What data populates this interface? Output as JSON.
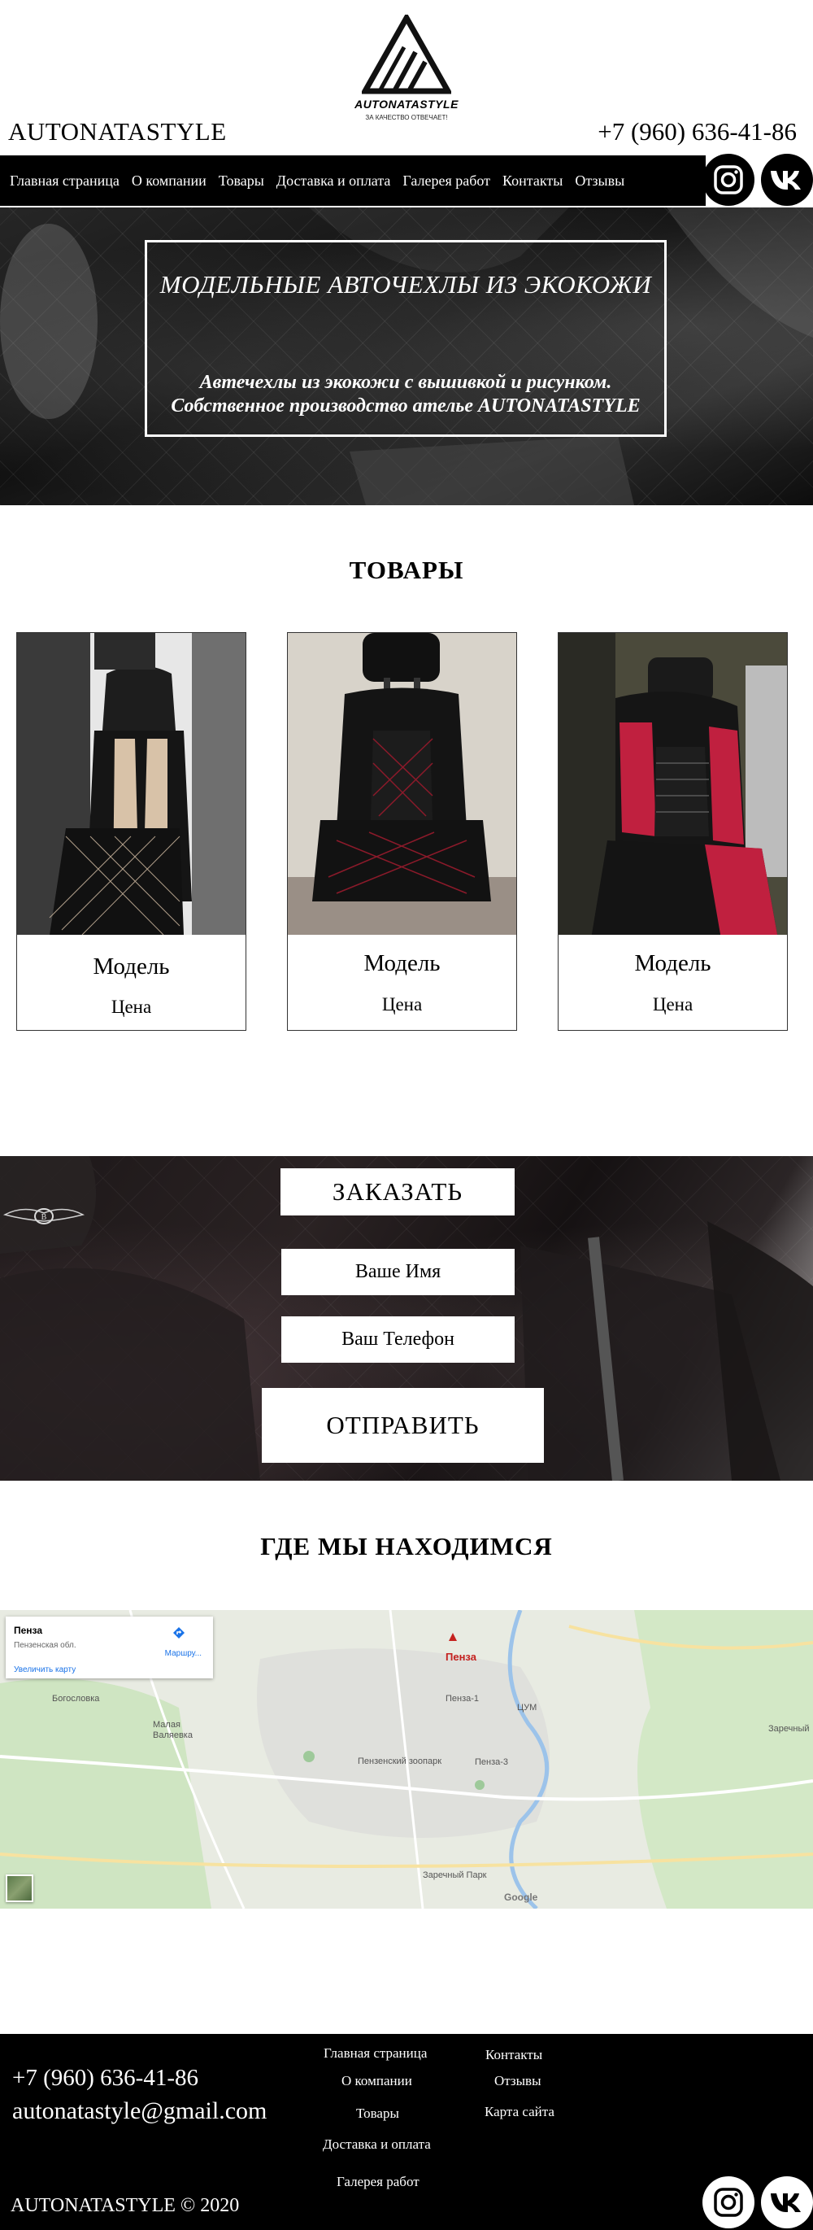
{
  "header": {
    "logo_name": "AUTONATASTYLE",
    "logo_tagline": "ЗА КАЧЕСТВО ОТВЕЧАЕТ!",
    "brand": "AUTONATASTYLE",
    "phone": "+7 (960) 636-41-86"
  },
  "nav": {
    "items": [
      {
        "label": "Главная страница"
      },
      {
        "label": "О компании"
      },
      {
        "label": "Товары"
      },
      {
        "label": "Доставка и оплата"
      },
      {
        "label": "Галерея работ"
      },
      {
        "label": "Контакты"
      },
      {
        "label": "Отзывы"
      }
    ]
  },
  "social": {
    "instagram": "instagram-icon",
    "vk": "vk-icon"
  },
  "hero": {
    "title": "МОДЕЛЬНЫЕ АВТОЧЕХЛЫ ИЗ ЭКОКОЖИ",
    "subtitle_line1": "Автечехлы из экокожи с вышивкой и рисунком.",
    "subtitle_line2": "Собственное производство ателье AUTONATASTYLE"
  },
  "products": {
    "title": "ТОВАРЫ",
    "items": [
      {
        "model": "Модель",
        "price": "Цена",
        "accent": "#d8c2a8"
      },
      {
        "model": "Модель",
        "price": "Цена",
        "accent": "#8b1a2a"
      },
      {
        "model": "Модель",
        "price": "Цена",
        "accent": "#c0203f"
      }
    ]
  },
  "order": {
    "title": "ЗАКАЗАТЬ",
    "name_placeholder": "Ваше Имя",
    "phone_placeholder": "Ваш Телефон",
    "submit_label": "ОТПРАВИТЬ"
  },
  "location": {
    "title": "ГДЕ МЫ НАХОДИМСЯ",
    "card_city": "Пенза",
    "card_region": "Пензенская обл.",
    "card_route": "Маршру...",
    "card_enlarge": "Увеличить карту",
    "labels": {
      "penza": "Пенза",
      "bogoslovka": "Богословка",
      "malaya_valyaevka": "Малая Валяевка",
      "penza1": "Пенза-1",
      "tsum": "ЦУМ",
      "zoo": "Пензенский зоопарк",
      "penza3": "Пенза-3",
      "zarechny_park": "Заречный Парк",
      "zarechny": "Заречный",
      "google": "Google"
    }
  },
  "footer": {
    "phone": "+7 (960) 636-41-86",
    "email": "autonatastyle@gmail.com",
    "copyright": "AUTONATASTYLE © 2020",
    "col1": [
      "Главная страница",
      "О компании",
      "Товары",
      "Доставка и оплата",
      "Галерея работ"
    ],
    "col2": [
      "Контакты",
      "Отзывы",
      "Карта сайта"
    ]
  },
  "colors": {
    "background": "#ffffff",
    "nav": "#000000",
    "footer": "#000000"
  }
}
